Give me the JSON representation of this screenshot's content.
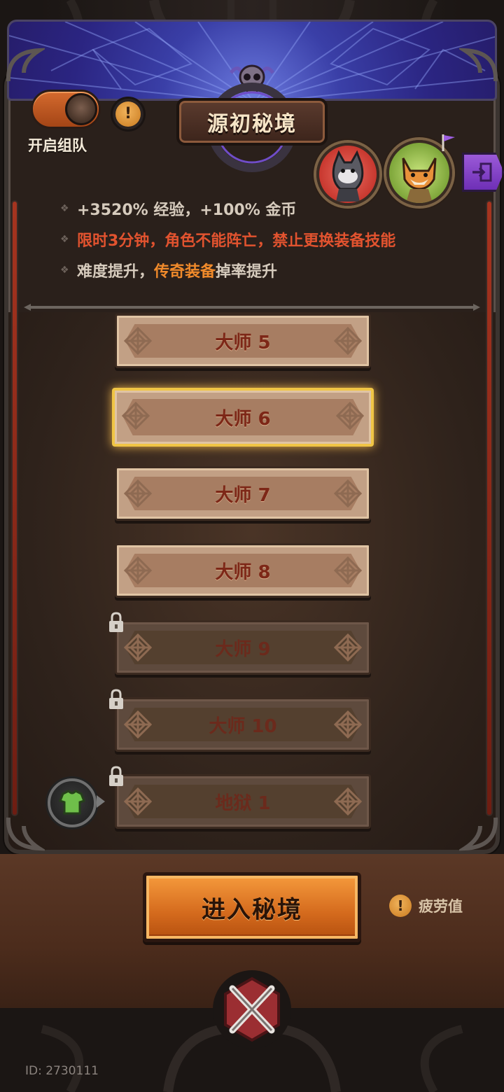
{
  "header": {
    "title": "源初秘境",
    "team_toggle_label": "开启组队",
    "info_glyph": "!"
  },
  "rules": {
    "line1": "+3520% 经验，+100% 金币",
    "line2": "限时3分钟，角色不能阵亡，禁止更换装备技能",
    "line3_prefix": "难度提升，",
    "line3_highlight": "传奇装备",
    "line3_suffix": " 掉率提升"
  },
  "levels": [
    {
      "label": "大师 5",
      "state": "available"
    },
    {
      "label": "大师 6",
      "state": "selected"
    },
    {
      "label": "大师 7",
      "state": "available"
    },
    {
      "label": "大师 8",
      "state": "available"
    },
    {
      "label": "大师 9",
      "state": "locked"
    },
    {
      "label": "大师 10",
      "state": "locked"
    },
    {
      "label": "地狱 1",
      "state": "locked"
    }
  ],
  "footer": {
    "enter_button": "进入秘境",
    "fatigue_label": "疲劳值",
    "fatigue_glyph": "!",
    "user_id": "ID: 2730111"
  },
  "icons": {
    "team_toggle": "toggle-switch",
    "info": "info-icon",
    "skull": "skull-icon",
    "avatar_cat": "cat-avatar-icon",
    "avatar_fox": "fox-avatar-icon",
    "exit": "exit-icon",
    "lock": "lock-icon",
    "reward": "armor-reward-icon",
    "emblem": "crossed-swords-icon"
  },
  "colors": {
    "accent_orange": "#d46a1d",
    "warning_red": "#e2532f",
    "legend_orange": "#f08a2b",
    "selected_border": "#f0c545",
    "header_blue": "#3a3fa7"
  }
}
